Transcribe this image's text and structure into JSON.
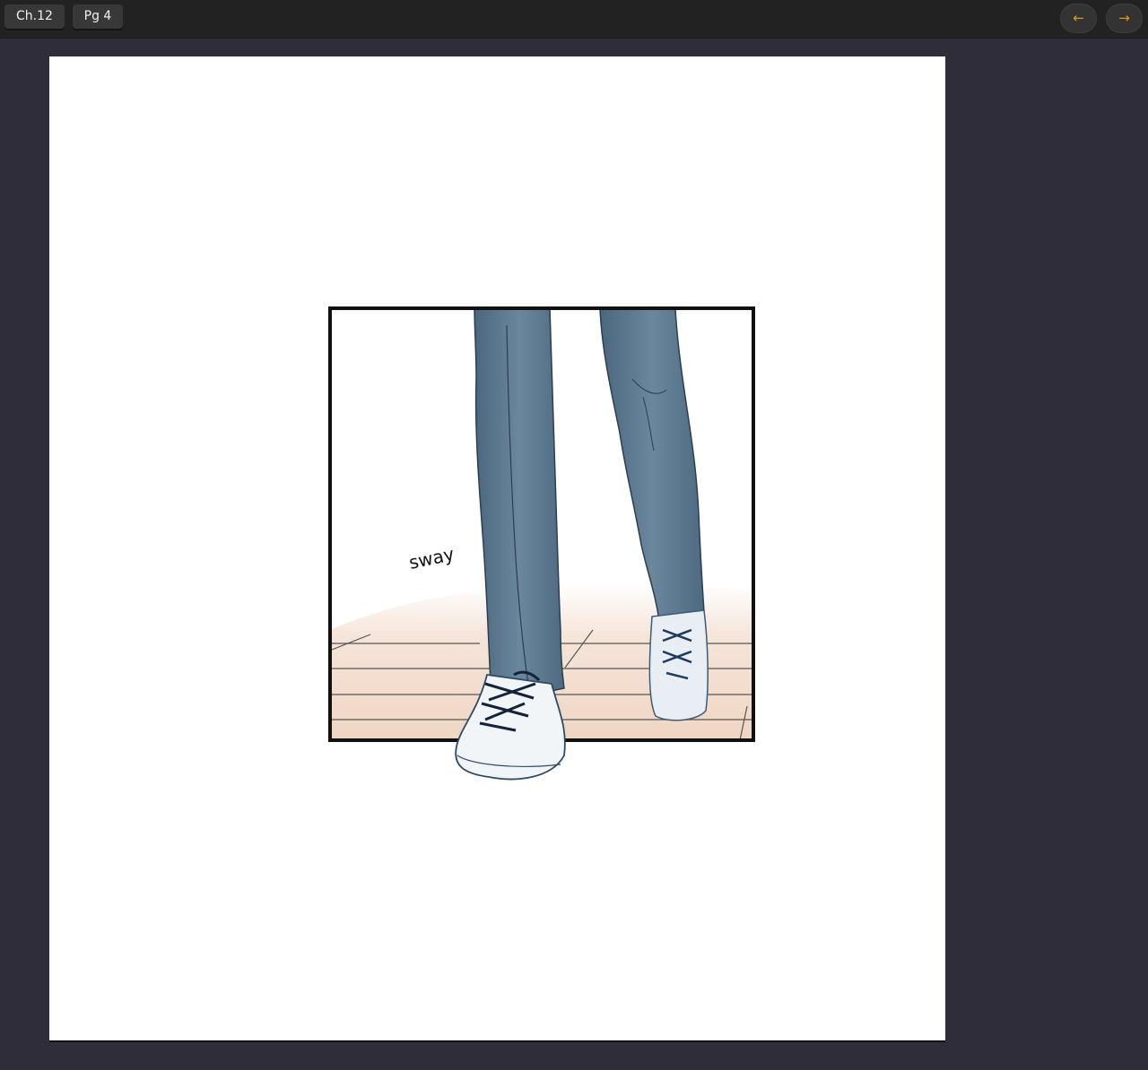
{
  "toolbar": {
    "chapter_label": "Ch.12",
    "page_label": "Pg 4",
    "prev_icon": "←",
    "next_icon": "→"
  },
  "comic": {
    "sfx_text": "sway"
  },
  "colors": {
    "background": "#2f2d3a",
    "toolbar": "#222222",
    "accent": "#d99a1e",
    "pants": "#55728a",
    "floor": "#f1d9c7"
  }
}
